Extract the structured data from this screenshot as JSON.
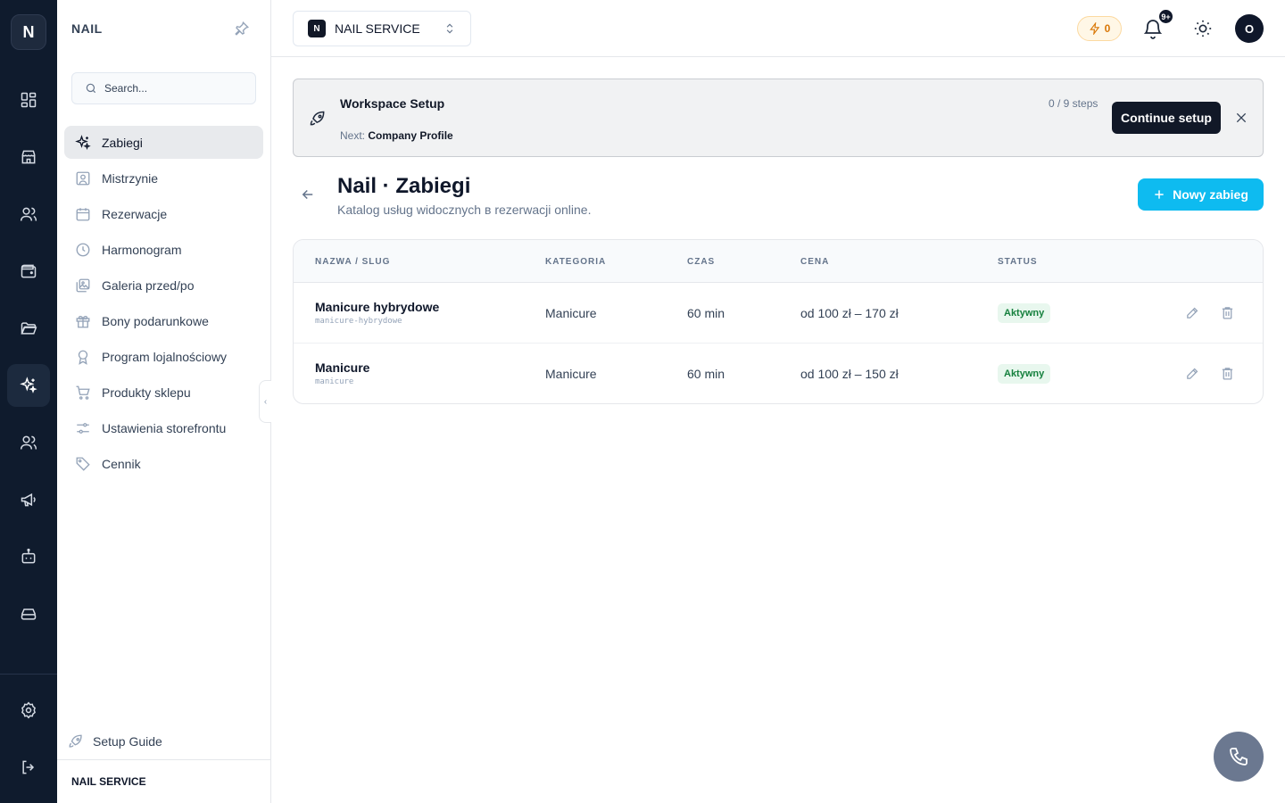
{
  "rail": {
    "logo": "N",
    "items": [
      "dashboard",
      "store",
      "users",
      "wallet",
      "folder",
      "services",
      "team",
      "megaphone",
      "bot",
      "storage"
    ],
    "bottom": [
      "settings",
      "logout"
    ]
  },
  "sidebar": {
    "title": "NAIL",
    "search_placeholder": "Search...",
    "items": [
      {
        "label": "Zabiegi",
        "icon": "sparkles-icon",
        "active": true
      },
      {
        "label": "Mistrzynie",
        "icon": "user-square-icon"
      },
      {
        "label": "Rezerwacje",
        "icon": "calendar-icon"
      },
      {
        "label": "Harmonogram",
        "icon": "clock-icon"
      },
      {
        "label": "Galeria przed/po",
        "icon": "gallery-icon"
      },
      {
        "label": "Bony podarunkowe",
        "icon": "gift-icon"
      },
      {
        "label": "Program lojalnościowy",
        "icon": "award-icon"
      },
      {
        "label": "Produkty sklepu",
        "icon": "cart-icon"
      },
      {
        "label": "Ustawienia storefrontu",
        "icon": "sliders-icon"
      },
      {
        "label": "Cennik",
        "icon": "tag-icon"
      }
    ],
    "setup_guide": "Setup Guide",
    "footer": "NAIL SERVICE"
  },
  "topbar": {
    "workspace_badge": "N",
    "workspace_name": "NAIL SERVICE",
    "credits": "0",
    "notifications_badge": "9+",
    "avatar": "O"
  },
  "banner": {
    "title": "Workspace Setup",
    "next_label": "Next:",
    "next_value": "Company Profile",
    "steps": "0 / 9 steps",
    "button": "Continue setup"
  },
  "page": {
    "title": "Nail · Zabiegi",
    "subtitle": "Katalog usług widocznych в rezerwacji online.",
    "new_button": "Nowy zabieg"
  },
  "table": {
    "headers": {
      "name": "NAZWA / SLUG",
      "category": "KATEGORIA",
      "time": "CZAS",
      "price": "CENA",
      "status": "STATUS"
    },
    "rows": [
      {
        "name": "Manicure hybrydowe",
        "slug": "manicure-hybrydowe",
        "category": "Manicure",
        "time": "60 min",
        "price": "od 100 zł – 170 zł",
        "status": "Aktywny"
      },
      {
        "name": "Manicure",
        "slug": "manicure",
        "category": "Manicure",
        "time": "60 min",
        "price": "od 100 zł – 150 zł",
        "status": "Aktywny"
      }
    ]
  },
  "colors": {
    "rail_bg": "#0f1b2d",
    "accent": "#0ebbf0",
    "status_green": "#15803d",
    "credits_amber": "#d97706"
  }
}
